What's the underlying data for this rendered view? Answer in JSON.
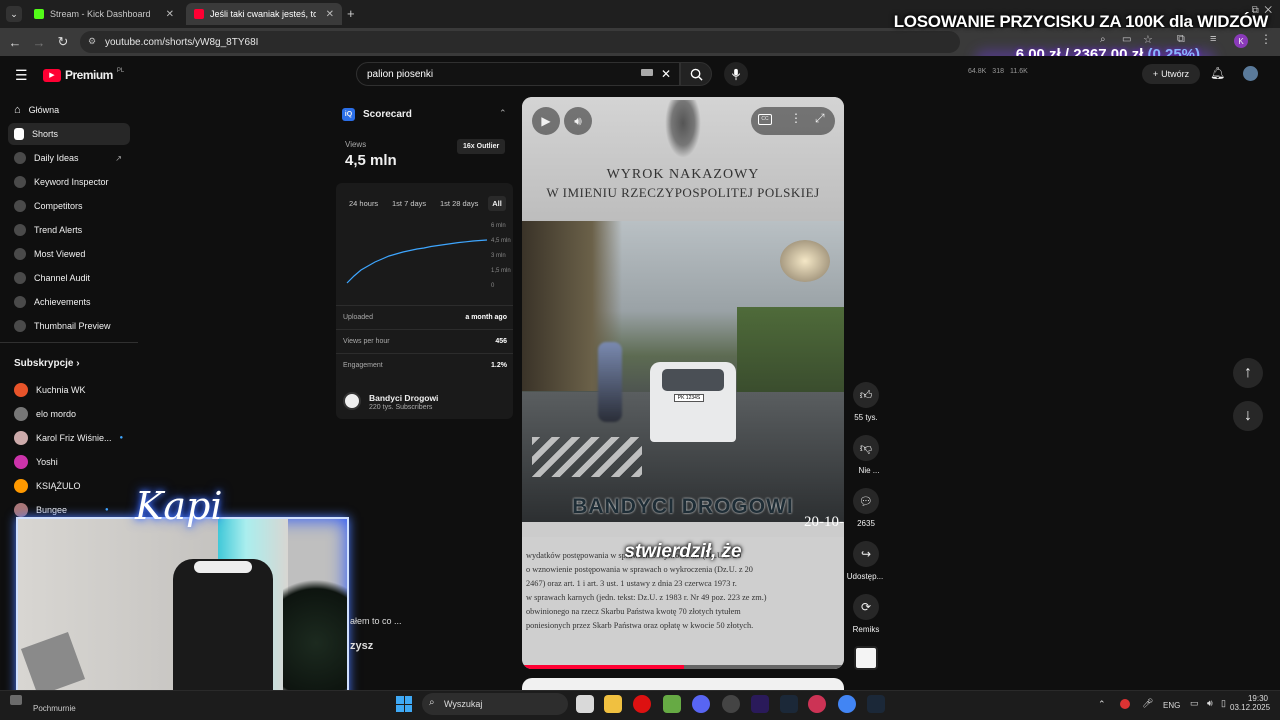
{
  "browser": {
    "tabs": [
      {
        "label": "Stream - Kick Dashboard",
        "active": false
      },
      {
        "label": "Jeśli taki cwaniak jesteś, to zobacz",
        "active": true
      }
    ],
    "url": "youtube.com/shorts/yW8g_8TY68I"
  },
  "overlay": {
    "title": "LOSOWANIE PRZYCISKU ZA 100K dla WIDZÓW",
    "amount_current": "6,00 zł",
    "separator": "/",
    "amount_goal": "2367,00 zł",
    "percent": "(0.25%)"
  },
  "youtube": {
    "logo_text": "Premium",
    "logo_region": "PL",
    "search_value": "palion piosenki",
    "create_label": "Utwórz",
    "stats": [
      "64.8K",
      "318",
      "11.6K"
    ]
  },
  "sidebar": {
    "items": [
      {
        "label": "Główna",
        "icon": "home-icon"
      },
      {
        "label": "Shorts",
        "icon": "shorts-icon",
        "active": true
      },
      {
        "label": "Daily Ideas",
        "icon": "extension-icon"
      },
      {
        "label": "Keyword Inspector",
        "icon": "extension-icon"
      },
      {
        "label": "Competitors",
        "icon": "extension-icon"
      },
      {
        "label": "Trend Alerts",
        "icon": "extension-icon"
      },
      {
        "label": "Most Viewed",
        "icon": "extension-icon"
      },
      {
        "label": "Channel Audit",
        "icon": "extension-icon"
      },
      {
        "label": "Achievements",
        "icon": "extension-icon"
      },
      {
        "label": "Thumbnail Preview",
        "icon": "extension-icon"
      }
    ],
    "subs_header": "Subskrypcje",
    "subscriptions": [
      {
        "label": "Kuchnia WK",
        "color": "#e8542a"
      },
      {
        "label": "elo mordo",
        "color": "#777"
      },
      {
        "label": "Karol Friz Wiśnie...",
        "color": "#caa"
      },
      {
        "label": "Yoshi",
        "color": "#c3a"
      },
      {
        "label": "KSIĄŻULO",
        "color": "#f90"
      },
      {
        "label": "Bungee",
        "color": "#a77"
      }
    ]
  },
  "scorecard": {
    "title": "Scorecard",
    "views_label": "Views",
    "views_value": "4,5 mln",
    "outlier_badge": "16x Outlier",
    "ranges": [
      "24 hours",
      "1st 7 days",
      "1st 28 days",
      "All"
    ],
    "active_range": "All",
    "y_ticks": [
      "6 mln",
      "4,5 mln",
      "3 mln",
      "1,5 mln",
      "0"
    ],
    "uploaded_label": "Uploaded",
    "uploaded_value": "a month ago",
    "vph_label": "Views per hour",
    "vph_value": "456",
    "engagement_label": "Engagement",
    "engagement_value": "1.2%",
    "channel_name": "Bandyci Drogowi",
    "channel_subs": "220 tys. Subscribers"
  },
  "chart_data": {
    "type": "line",
    "x": [
      0,
      1,
      2,
      3,
      4,
      5,
      6,
      7,
      8,
      9,
      10,
      11,
      12,
      13,
      14,
      15,
      16,
      17,
      18,
      19,
      20
    ],
    "values": [
      0.2,
      0.9,
      1.5,
      1.9,
      2.3,
      2.6,
      2.9,
      3.1,
      3.3,
      3.45,
      3.6,
      3.7,
      3.85,
      3.95,
      4.05,
      4.15,
      4.25,
      4.32,
      4.4,
      4.45,
      4.5
    ],
    "ylim": [
      0,
      6
    ],
    "y_tick_labels": [
      "0",
      "1,5 mln",
      "3 mln",
      "4,5 mln",
      "6 mln"
    ],
    "color": "#3ea6ff"
  },
  "video": {
    "doc_title_1": "WYROK NAKAZOWY",
    "doc_title_2": "W IMIENIU RZECZYPOSPOLITEJ POLSKIEJ",
    "watermark": "BANDYCI DROGOWI",
    "date_stamp": "20-10-",
    "caption": "stwierdził, że",
    "plate": "PK 1234S",
    "doc_text": [
      "wydatków postępowania w sprawach o wykroczenia (Dz.U. z 20",
      "o wznowienie postępowania w sprawach o wykroczenia (Dz.U. z 20",
      "2467) oraz art. 1 i art. 3 ust. 1 ustawy z dnia 23 czerwca 1973 r.",
      "w sprawach karnych (jedn. tekst: Dz.U. z 1983 r. Nr 49 poz. 223 ze zm.)",
      "obwinionego na rzecz Skarbu Państwa kwotę 70 złotych tytułem",
      "poniesionych przez Skarb Państwa oraz opłatę w kwocie 50 złotych."
    ]
  },
  "actions": {
    "likes": "55 tys.",
    "dislike": "Nie ...",
    "comments": "2635",
    "share": "Udostęp...",
    "remix": "Remiks"
  },
  "stream": {
    "neon_name": "Kapi",
    "comment_1": "ałem to co ...",
    "comment_2": "zysz",
    "weather": "Pochmurnie"
  },
  "taskbar": {
    "search": "Wyszukaj",
    "lang": "ENG",
    "time": "19:30",
    "date": "03.12.2025"
  }
}
